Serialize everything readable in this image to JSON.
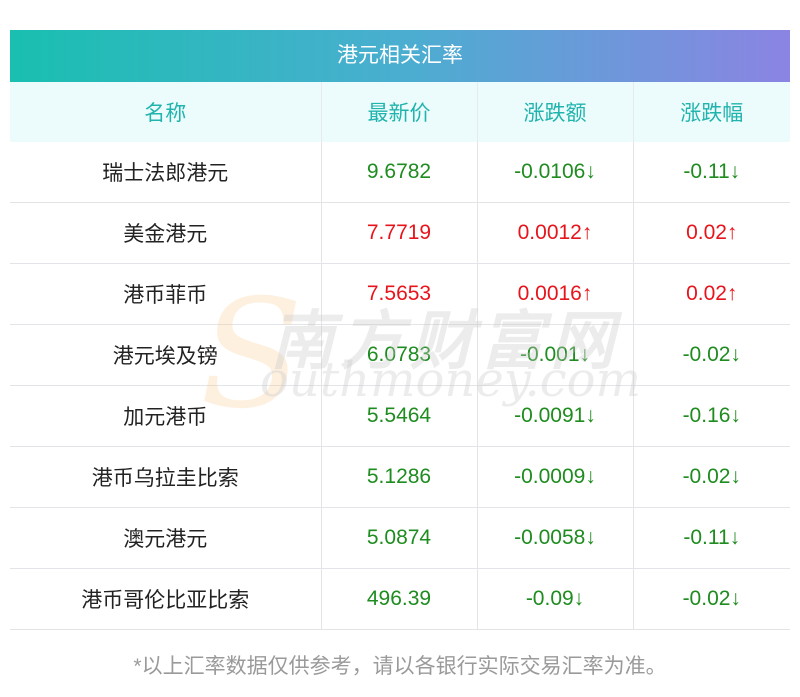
{
  "title": "港元相关汇率",
  "columns": [
    "名称",
    "最新价",
    "涨跌额",
    "涨跌幅"
  ],
  "rows": [
    {
      "name": "瑞士法郎港元",
      "price": "9.6782",
      "change": "-0.0106↓",
      "pct": "-0.11↓",
      "direction": "down"
    },
    {
      "name": "美金港元",
      "price": "7.7719",
      "change": "0.0012↑",
      "pct": "0.02↑",
      "direction": "up"
    },
    {
      "name": "港币菲币",
      "price": "7.5653",
      "change": "0.0016↑",
      "pct": "0.02↑",
      "direction": "up"
    },
    {
      "name": "港元埃及镑",
      "price": "6.0783",
      "change": "-0.001↓",
      "pct": "-0.02↓",
      "direction": "down"
    },
    {
      "name": "加元港币",
      "price": "5.5464",
      "change": "-0.0091↓",
      "pct": "-0.16↓",
      "direction": "down"
    },
    {
      "name": "港币乌拉圭比索",
      "price": "5.1286",
      "change": "-0.0009↓",
      "pct": "-0.02↓",
      "direction": "down"
    },
    {
      "name": "澳元港元",
      "price": "5.0874",
      "change": "-0.0058↓",
      "pct": "-0.11↓",
      "direction": "down"
    },
    {
      "name": "港币哥伦比亚比索",
      "price": "496.39",
      "change": "-0.09↓",
      "pct": "-0.02↓",
      "direction": "down"
    }
  ],
  "watermark": {
    "letter": "S",
    "chinese": "南方财富网",
    "english": "outhmoney.com"
  },
  "footnote": "*以上汇率数据仅供参考，请以各银行实际交易汇率为准。",
  "colors": {
    "up": "#e8141c",
    "down": "#1e8c1f",
    "header_text": "#21b3ad",
    "title_gradient_start": "#19bfb0",
    "title_gradient_end": "#8b84e3"
  }
}
